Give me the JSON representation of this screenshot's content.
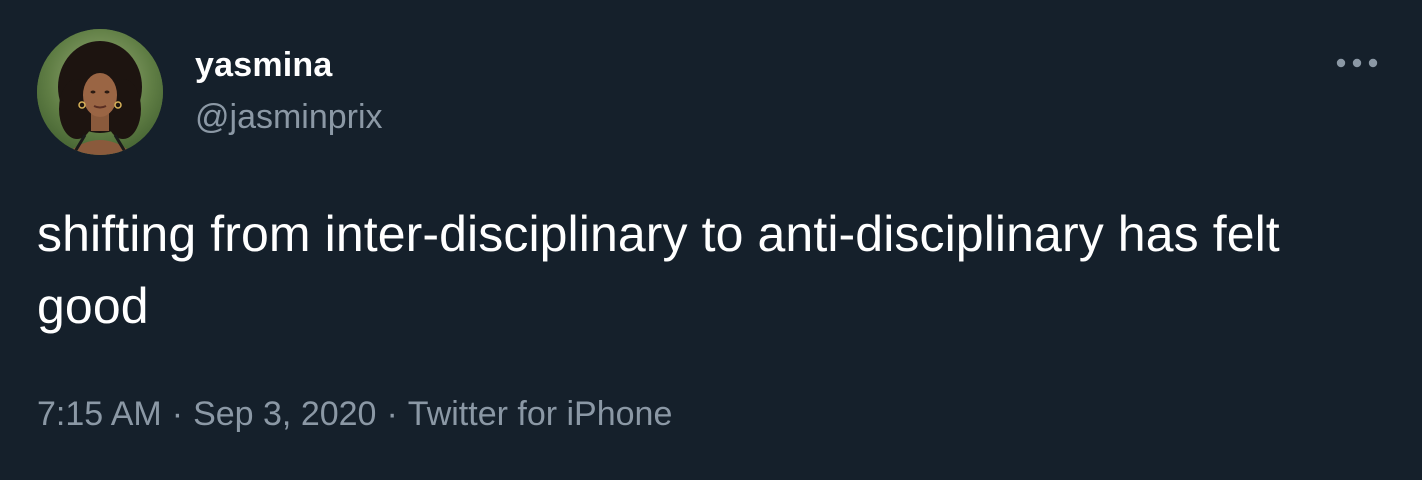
{
  "tweet": {
    "author": {
      "display_name": "yasmina",
      "handle": "@jasminprix",
      "avatar_icon": "profile-photo"
    },
    "text": "shifting from inter-disciplinary to anti-disciplinary has felt good",
    "time": "7:15 AM",
    "date": "Sep 3, 2020",
    "source": "Twitter for iPhone",
    "separator": "·",
    "more_icon": "more-options-icon"
  },
  "colors": {
    "background": "#15202b",
    "primary_text": "#ffffff",
    "secondary_text": "#8b98a5"
  }
}
